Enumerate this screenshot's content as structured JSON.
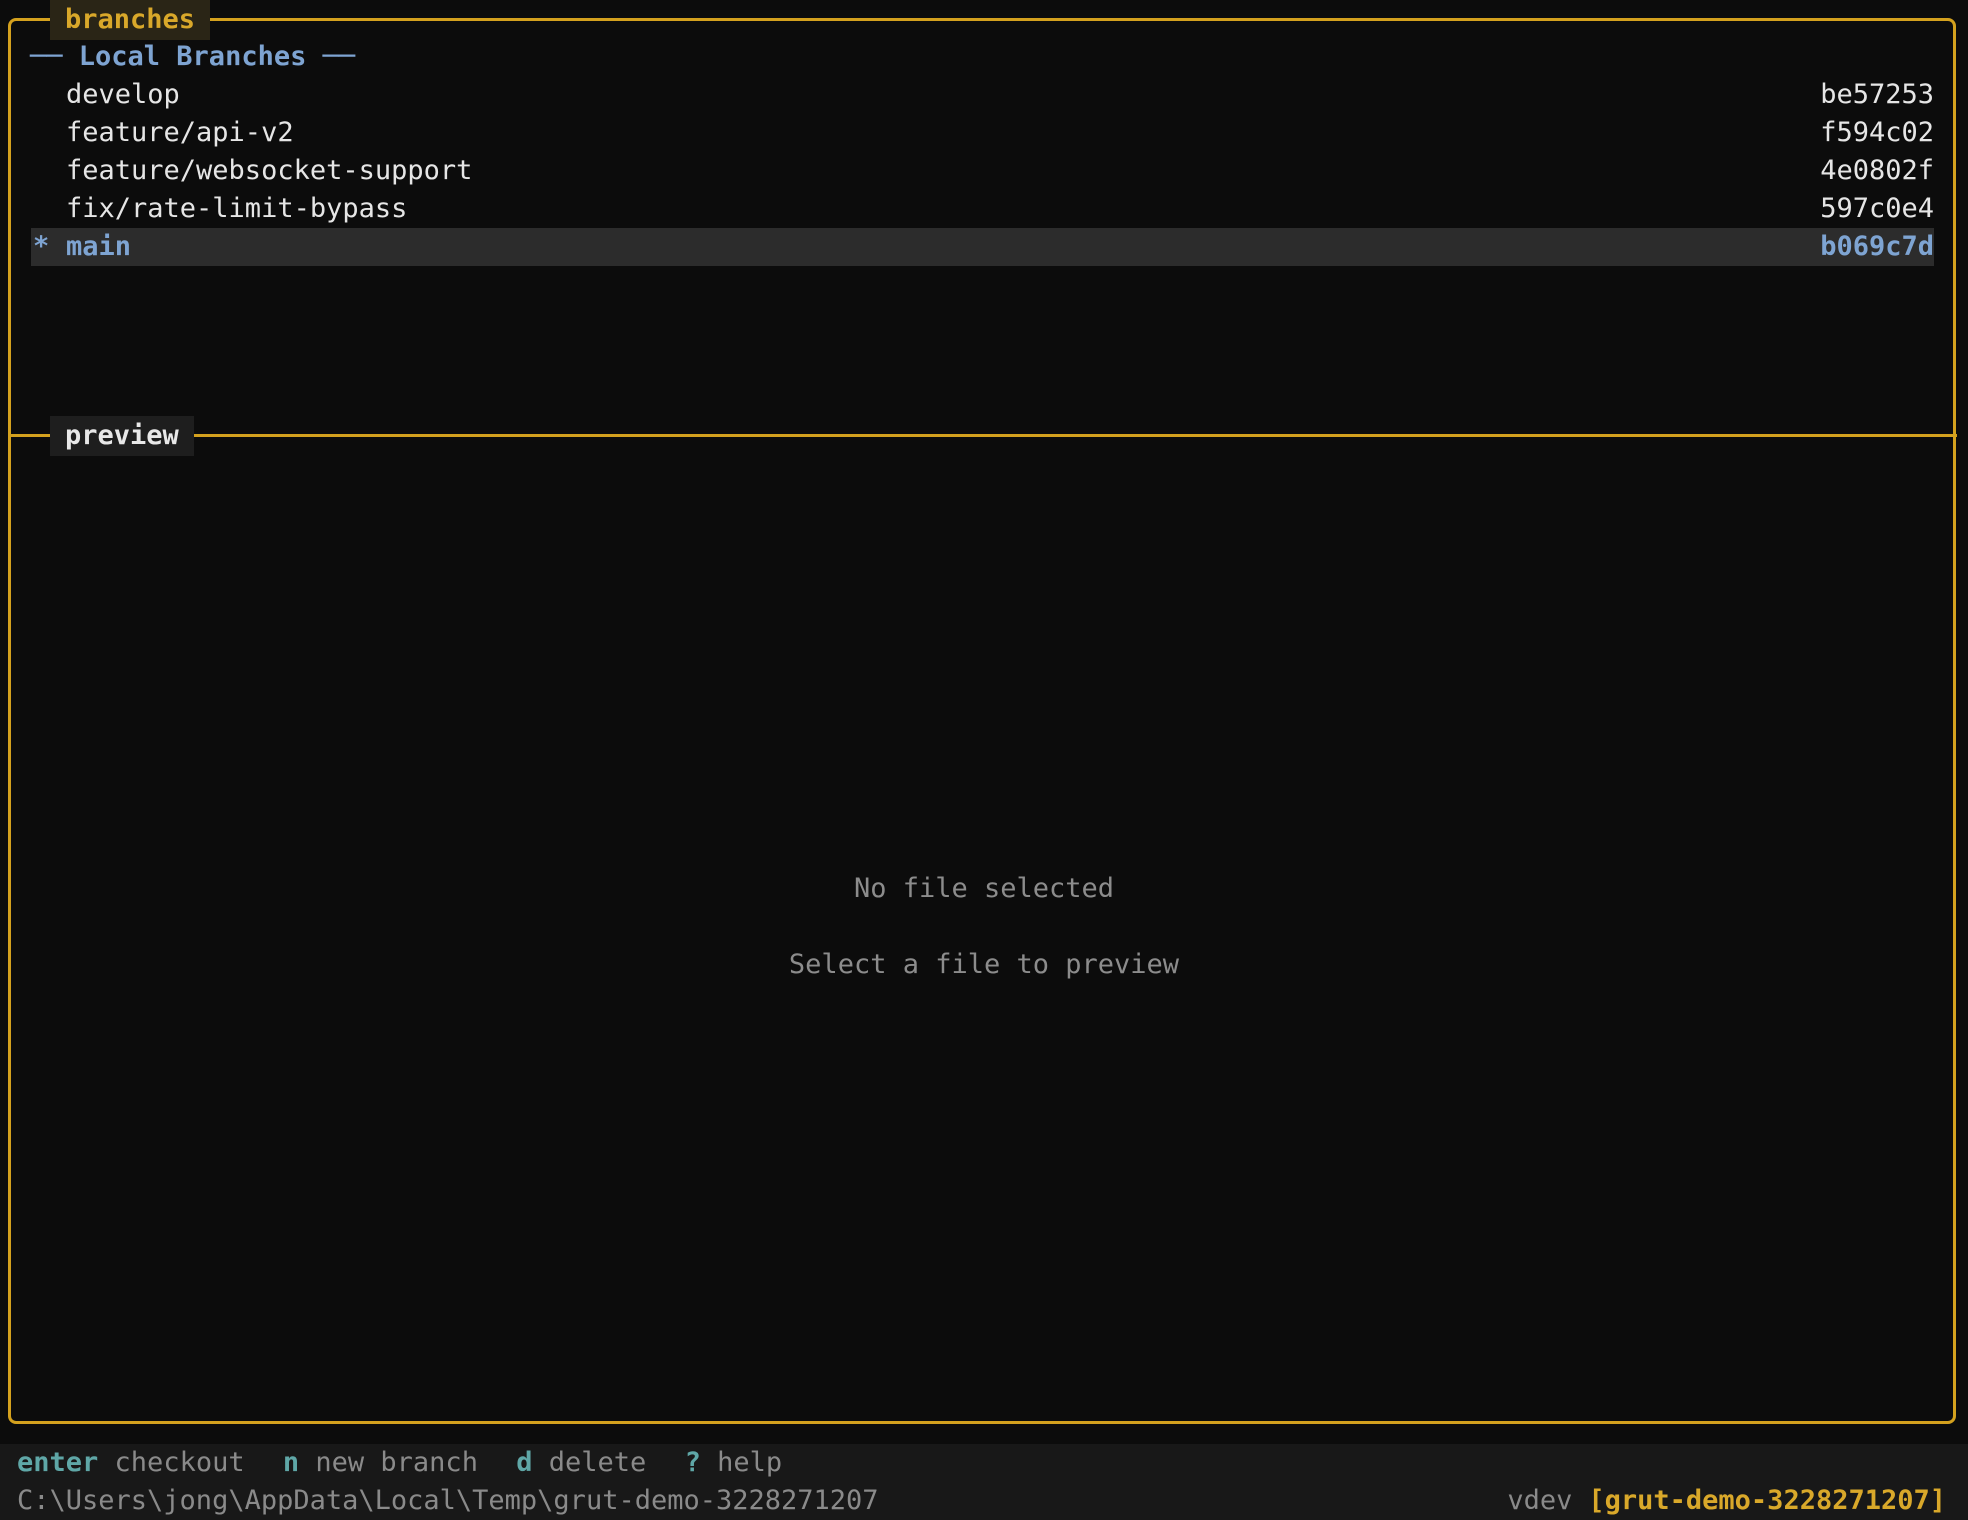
{
  "panels": {
    "branches_title": "branches",
    "preview_title": "preview"
  },
  "branch_section": {
    "header": "── Local Branches ──",
    "items": [
      {
        "marker": "",
        "name": "develop",
        "hash": "be57253",
        "current": false
      },
      {
        "marker": "",
        "name": "feature/api-v2",
        "hash": "f594c02",
        "current": false
      },
      {
        "marker": "",
        "name": "feature/websocket-support",
        "hash": "4e0802f",
        "current": false
      },
      {
        "marker": "",
        "name": "fix/rate-limit-bypass",
        "hash": "597c0e4",
        "current": false
      },
      {
        "marker": "*",
        "name": "main",
        "hash": "b069c7d",
        "current": true
      }
    ]
  },
  "preview": {
    "empty_title": "No file selected",
    "empty_hint": "Select a file to preview"
  },
  "keybar": [
    {
      "key": "enter",
      "action": "checkout"
    },
    {
      "key": "n",
      "action": "new branch"
    },
    {
      "key": "d",
      "action": "delete"
    },
    {
      "key": "?",
      "action": "help"
    }
  ],
  "status": {
    "path": "C:\\Users\\jong\\AppData\\Local\\Temp\\grut-demo-3228271207",
    "version": "vdev",
    "repo": "[grut-demo-3228271207]"
  },
  "colors": {
    "border": "#d4a11e",
    "accent_blue": "#7ea4d2",
    "key_teal": "#5fa7a7",
    "background": "#0c0c0c"
  }
}
